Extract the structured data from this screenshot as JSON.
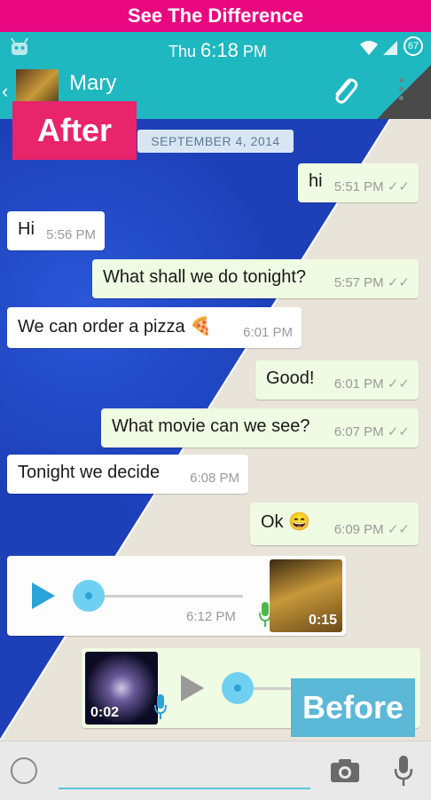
{
  "banner": {
    "title": "See The Difference"
  },
  "status_bar": {
    "day": "Thu",
    "time": "6:18",
    "ampm": "PM",
    "battery": "67"
  },
  "header": {
    "contact_name": "Mary"
  },
  "chat": {
    "date_chip": "SEPTEMBER 4, 2014",
    "messages": [
      {
        "dir": "out",
        "text": "hi",
        "time": "5:51 PM"
      },
      {
        "dir": "in",
        "text": "Hi",
        "time": "5:56 PM"
      },
      {
        "dir": "out",
        "text": "What shall we do tonight?",
        "time": "5:57 PM"
      },
      {
        "dir": "in",
        "text": "We can order a pizza",
        "emoji": "🍕",
        "time": "6:01 PM"
      },
      {
        "dir": "out",
        "text": "Good!",
        "time": "6:01 PM"
      },
      {
        "dir": "out",
        "text": "What movie can we see?",
        "time": "6:07 PM"
      },
      {
        "dir": "in",
        "text": "Tonight we decide",
        "time": "6:08 PM"
      },
      {
        "dir": "out",
        "text": "Ok",
        "emoji": "😄",
        "time": "6:09 PM"
      }
    ],
    "voice_messages": [
      {
        "dir": "in",
        "duration": "0:15",
        "time": "6:12 PM"
      },
      {
        "dir": "out",
        "duration": "0:02"
      }
    ]
  },
  "labels": {
    "after": "After",
    "before": "Before"
  },
  "icons": [
    "android-icon",
    "wifi-icon",
    "signal-icon",
    "battery-icon",
    "back-icon",
    "attach-icon",
    "menu-icon",
    "play-icon",
    "mic-icon",
    "smiley-icon",
    "camera-icon"
  ],
  "colors": {
    "banner": "#e8077f",
    "appbar": "#1fb7c0",
    "after_tag": "#e8246b",
    "before_tag": "#5bb8d6",
    "outgoing_bubble": "#effbe2",
    "incoming_bubble": "#ffffff",
    "after_background": "#1d40b8"
  }
}
